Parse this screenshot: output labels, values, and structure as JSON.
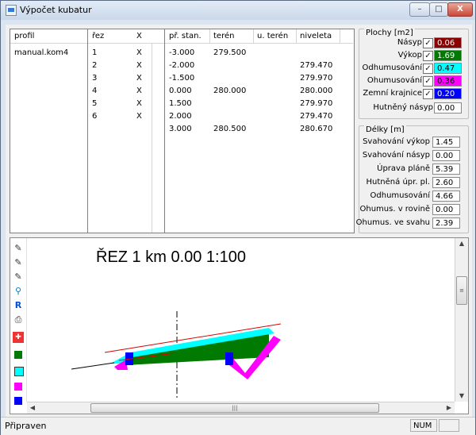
{
  "window": {
    "title": "Výpočet kubatur",
    "min": "–",
    "max": "□",
    "close": "X"
  },
  "profiles": {
    "header": "profil",
    "items": [
      "manual.kom4"
    ]
  },
  "sections": {
    "header_rez": "řez",
    "header_x": "X",
    "rows": [
      {
        "n": "1",
        "x": "X"
      },
      {
        "n": "2",
        "x": "X"
      },
      {
        "n": "3",
        "x": "X"
      },
      {
        "n": "4",
        "x": "X"
      },
      {
        "n": "5",
        "x": "X"
      },
      {
        "n": "6",
        "x": "X"
      }
    ]
  },
  "points": {
    "headers": [
      "př. stan.",
      "terén",
      "u. terén",
      "niveleta"
    ],
    "rows": [
      [
        "-3.000",
        "279.500",
        "",
        ""
      ],
      [
        "-2.000",
        "",
        "",
        "279.470"
      ],
      [
        "-1.500",
        "",
        "",
        "279.970"
      ],
      [
        "0.000",
        "280.000",
        "",
        "280.000"
      ],
      [
        "1.500",
        "",
        "",
        "279.970"
      ],
      [
        "2.000",
        "",
        "",
        "279.470"
      ],
      [
        "3.000",
        "280.500",
        "",
        "280.670"
      ]
    ]
  },
  "areas": {
    "title": "Plochy [m2]",
    "items": [
      {
        "label": "Násyp",
        "value": "0.06",
        "color": "#8b0000",
        "text": "#ffffff"
      },
      {
        "label": "Výkop",
        "value": "1.69",
        "color": "#007a00",
        "text": "#ffffff"
      },
      {
        "label": "Odhumusování",
        "value": "0.47",
        "color": "#00ffff",
        "text": "#000000"
      },
      {
        "label": "Ohumusování",
        "value": "0.36",
        "color": "#ff00ff",
        "text": "#000000"
      },
      {
        "label": "Zemní krajnice",
        "value": "0.20",
        "color": "#0000ff",
        "text": "#ffffff"
      },
      {
        "label": "Hutněný násyp",
        "value": "0.00",
        "color": "#ffffff",
        "text": "#000000"
      }
    ]
  },
  "lengths": {
    "title": "Délky [m]",
    "items": [
      {
        "label": "Svahování výkop",
        "value": "1.45"
      },
      {
        "label": "Svahování násyp",
        "value": "0.00"
      },
      {
        "label": "Úprava pláně",
        "value": "5.39"
      },
      {
        "label": "Hutněná úpr. pl.",
        "value": "2.60"
      },
      {
        "label": "Odhumusování",
        "value": "4.66"
      },
      {
        "label": "Ohumus. v rovině",
        "value": "0.00"
      },
      {
        "label": "Ohumus. ve svahu",
        "value": "2.39"
      }
    ]
  },
  "drawing": {
    "title": "ŘEZ 1 km 0.00 1:100"
  },
  "status": {
    "text": "Připraven",
    "num": "NUM"
  }
}
